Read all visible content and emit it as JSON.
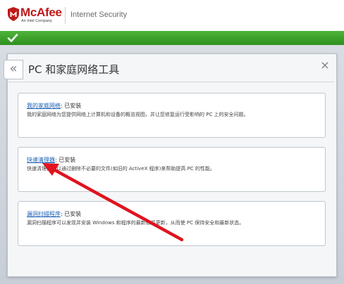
{
  "header": {
    "brand": "McAfee",
    "brand_tagline": "An Intel Company",
    "product": "Internet Security"
  },
  "panel": {
    "title": "PC 和家庭网络工具",
    "back_glyph": "«",
    "close_glyph": "×"
  },
  "cards": [
    {
      "link": "我的家庭网络",
      "status": ": 已安装",
      "description": "我的家庭网络为您提供网络上计算机和设备的概览视图，并让您修复运行受影响的 PC 上的安全问题。"
    },
    {
      "link": "快速清理器",
      "status": ": 已安装",
      "description": "快速清理器可以通过删除不必要的文件(如旧的 ActiveX 程序)来帮助提高 PC 的性能。"
    },
    {
      "link": "漏洞扫描程序",
      "status": ": 已安装",
      "description": "漏洞扫描程序可以发现并安装 Windows 和程序的最新软件更新，从而使 PC 保持安全和最新状态。"
    }
  ],
  "colors": {
    "brand_red": "#c01818",
    "status_green": "#3aa52a",
    "annotation_red": "#e0141e",
    "link_blue": "#1a5fb4"
  },
  "icons": {
    "status": "checkmark-icon",
    "back": "double-chevron-left-icon",
    "close": "close-icon",
    "logo": "mcafee-shield-icon"
  }
}
